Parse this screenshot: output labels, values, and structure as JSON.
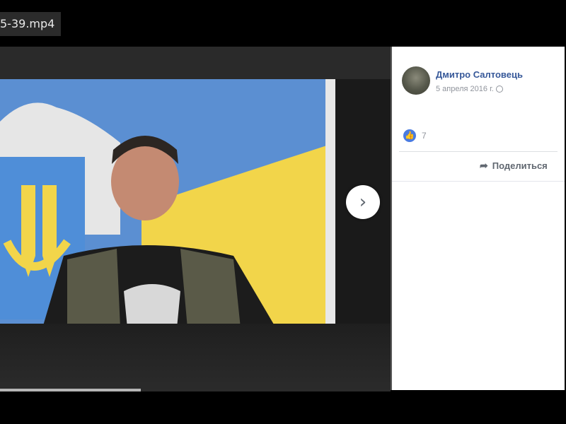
{
  "window": {
    "file_name": "5-39.mp4"
  },
  "viewer": {
    "next_icon": "chevron-right-icon",
    "next_label": "›",
    "progress": 0.36
  },
  "post": {
    "author": "Дмитро Салтовець",
    "date": "5 апреля 2016 г.",
    "privacy_icon": "globe-icon",
    "reactions": {
      "icon": "like-icon",
      "count": "7"
    },
    "share_label": "Поделиться",
    "share_icon": "share-arrow-icon"
  },
  "colors": {
    "link": "#365899",
    "secondary": "#90949c",
    "like": "#4a7be0",
    "flag_blue": "#5b8fd2",
    "flag_yellow": "#f2d54a"
  }
}
